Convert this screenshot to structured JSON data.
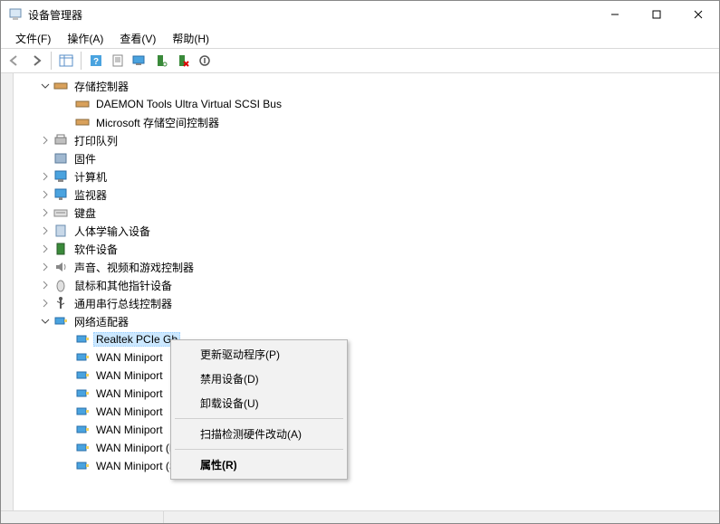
{
  "title": "设备管理器",
  "menubar": {
    "file": "文件(F)",
    "action": "操作(A)",
    "view": "查看(V)",
    "help": "帮助(H)"
  },
  "tree": {
    "storage_controllers": "存储控制器",
    "storage_child_1": "DAEMON Tools Ultra Virtual SCSI Bus",
    "storage_child_2": "Microsoft 存储空间控制器",
    "print_queues": "打印队列",
    "firmware": "固件",
    "computer": "计算机",
    "monitors": "监视器",
    "keyboards": "键盘",
    "hid": "人体学输入设备",
    "software_devices": "软件设备",
    "sound": "声音、视频和游戏控制器",
    "mice": "鼠标和其他指针设备",
    "usb": "通用串行总线控制器",
    "network_adapters": "网络适配器",
    "na_realtek": "Realtek PCIe Gb",
    "na_wan_1": "WAN Miniport",
    "na_wan_2": "WAN Miniport",
    "na_wan_3": "WAN Miniport",
    "na_wan_4": "WAN Miniport",
    "na_wan_5": "WAN Miniport",
    "na_wan_pptp": "WAN Miniport (PPTP)",
    "na_wan_sstp": "WAN Miniport (SSTP)"
  },
  "context_menu": {
    "update_driver": "更新驱动程序(P)",
    "disable_device": "禁用设备(D)",
    "uninstall_device": "卸载设备(U)",
    "scan_hardware": "扫描检测硬件改动(A)",
    "properties": "属性(R)"
  }
}
